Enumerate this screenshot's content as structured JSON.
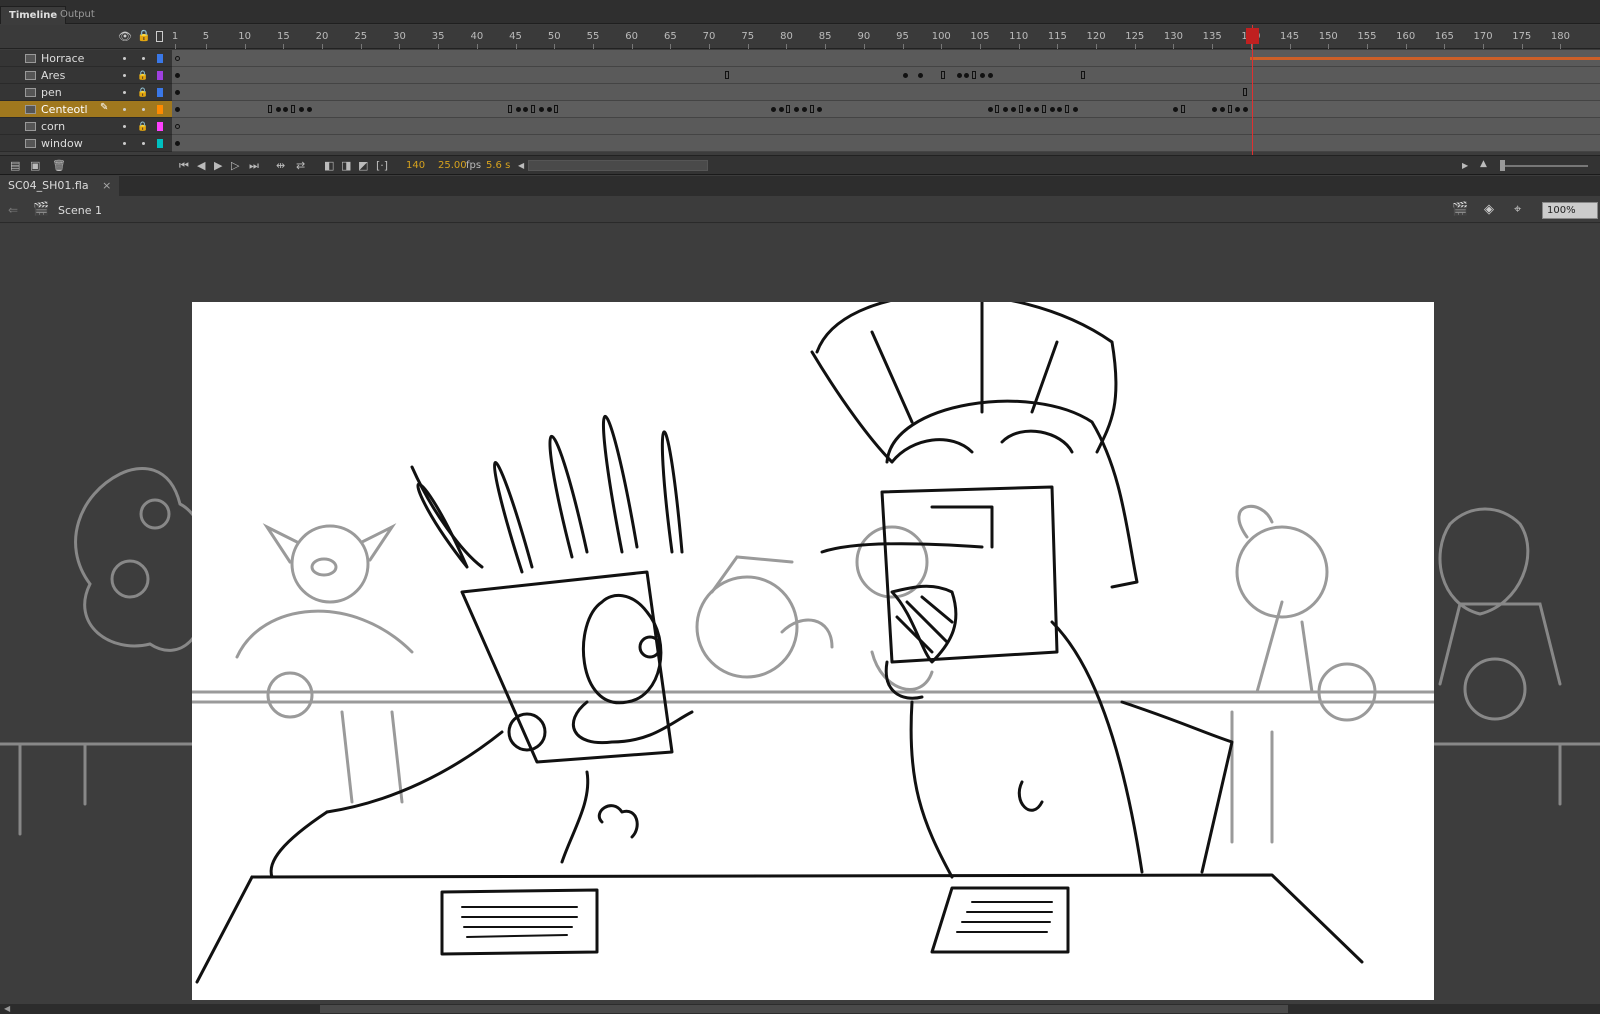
{
  "panel_tabs": {
    "timeline": "Timeline",
    "output": "Output"
  },
  "frame_numbers": [
    "1",
    "5",
    "10",
    "15",
    "20",
    "25",
    "30",
    "35",
    "40",
    "45",
    "50",
    "55",
    "60",
    "65",
    "70",
    "75",
    "80",
    "85",
    "90",
    "95",
    "100",
    "105",
    "110",
    "115",
    "120",
    "125",
    "130",
    "135",
    "140",
    "145",
    "150",
    "155",
    "160",
    "165",
    "170",
    "175",
    "180"
  ],
  "layers": [
    {
      "name": "Horrace",
      "color": "#3a78e8",
      "locked": false
    },
    {
      "name": "Ares",
      "color": "#a040e0",
      "locked": true
    },
    {
      "name": "pen",
      "color": "#3a78e8",
      "locked": true
    },
    {
      "name": "Centeotl",
      "color": "#ff8a00",
      "locked": false
    },
    {
      "name": "corn",
      "color": "#ff40ff",
      "locked": true
    },
    {
      "name": "window",
      "color": "#00c0c0",
      "locked": false
    }
  ],
  "footer": {
    "current_frame": "140",
    "fps": "25.00",
    "fps_unit": "fps",
    "time": "5.6 s"
  },
  "document": {
    "tab": "SC04_SH01.fla",
    "close": "×"
  },
  "scene": {
    "name": "Scene 1",
    "zoom": "100%"
  },
  "icons": [
    "eye-icon",
    "lock-icon",
    "outline-icon",
    "play-icon",
    "scene-icon",
    "zoom-select"
  ]
}
